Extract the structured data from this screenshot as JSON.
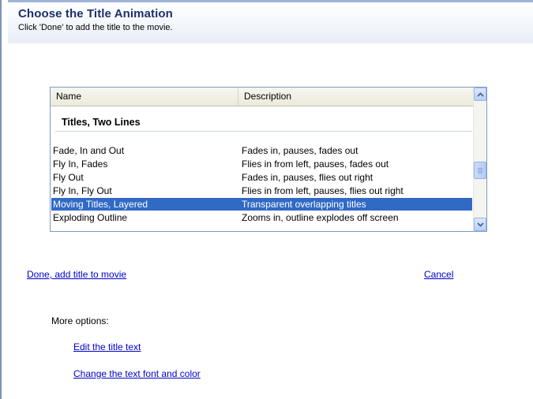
{
  "header": {
    "title": "Choose the Title Animation",
    "subtitle": "Click 'Done' to add the title to the movie."
  },
  "list": {
    "columns": [
      "Name",
      "Description"
    ],
    "group_title": "Titles, Two Lines",
    "rows": [
      {
        "name": "Fade, In and Out",
        "description": "Fades in, pauses, fades out"
      },
      {
        "name": "Fly In, Fades",
        "description": "Flies in from left, pauses, fades out"
      },
      {
        "name": "Fly Out",
        "description": "Fades in, pauses, flies out right"
      },
      {
        "name": "Fly In, Fly Out",
        "description": "Flies in from left, pauses, flies out right"
      },
      {
        "name": "Moving Titles, Layered",
        "description": "Transparent overlapping titles"
      },
      {
        "name": "Exploding Outline",
        "description": "Zooms in, outline explodes off screen"
      }
    ],
    "selected_index": 4
  },
  "actions": {
    "done": "Done, add title to movie",
    "cancel": "Cancel"
  },
  "more_options": {
    "label": "More options:",
    "edit_text": "Edit the title text",
    "change_font": "Change the text font and color"
  },
  "colors": {
    "selection": "#316ac5",
    "link": "#0000cc",
    "title": "#1d2f6a"
  }
}
